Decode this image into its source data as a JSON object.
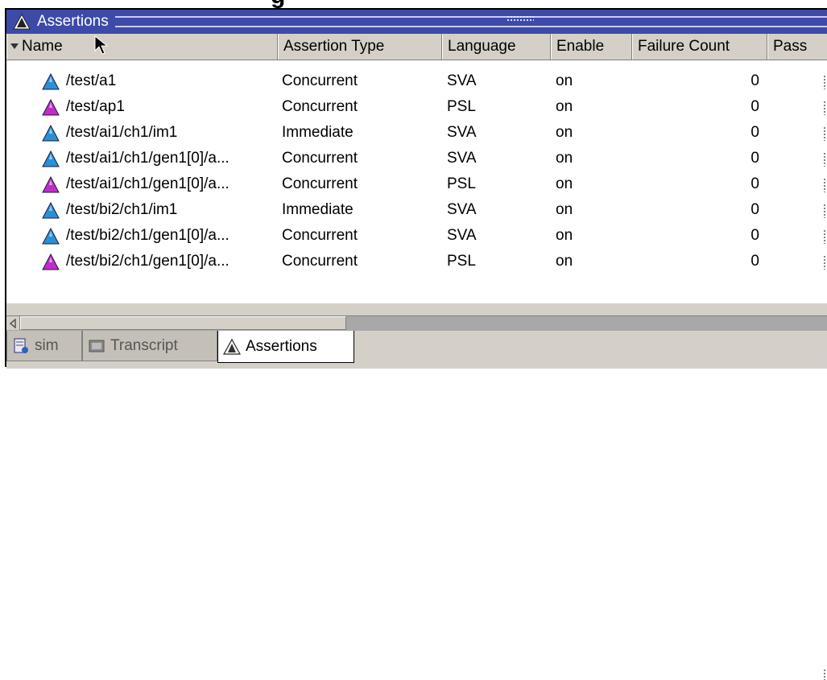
{
  "window": {
    "title": "Assertions",
    "cut_off_heading": "g"
  },
  "columns": [
    {
      "key": "name",
      "label": "Name"
    },
    {
      "key": "type",
      "label": "Assertion Type"
    },
    {
      "key": "language",
      "label": "Language"
    },
    {
      "key": "enable",
      "label": "Enable"
    },
    {
      "key": "failure_count",
      "label": "Failure Count"
    },
    {
      "key": "pass",
      "label": "Pass"
    }
  ],
  "rows": [
    {
      "name": "/test/a1",
      "type": "Concurrent",
      "language": "SVA",
      "enable": "on",
      "failure_count": "0",
      "icon": "sva-assertion-icon",
      "icon_color": "#2b8fd6"
    },
    {
      "name": "/test/ap1",
      "type": "Concurrent",
      "language": "PSL",
      "enable": "on",
      "failure_count": "0",
      "icon": "psl-assertion-icon",
      "icon_color": "#c02cc8"
    },
    {
      "name": "/test/ai1/ch1/im1",
      "type": "Immediate",
      "language": "SVA",
      "enable": "on",
      "failure_count": "0",
      "icon": "sva-assertion-icon",
      "icon_color": "#2b8fd6"
    },
    {
      "name": "/test/ai1/ch1/gen1[0]/a...",
      "type": "Concurrent",
      "language": "SVA",
      "enable": "on",
      "failure_count": "0",
      "icon": "sva-assertion-icon",
      "icon_color": "#2b8fd6"
    },
    {
      "name": "/test/ai1/ch1/gen1[0]/a...",
      "type": "Concurrent",
      "language": "PSL",
      "enable": "on",
      "failure_count": "0",
      "icon": "psl-assertion-icon",
      "icon_color": "#c02cc8"
    },
    {
      "name": "/test/bi2/ch1/im1",
      "type": "Immediate",
      "language": "SVA",
      "enable": "on",
      "failure_count": "0",
      "icon": "sva-assertion-icon",
      "icon_color": "#2b8fd6"
    },
    {
      "name": "/test/bi2/ch1/gen1[0]/a...",
      "type": "Concurrent",
      "language": "SVA",
      "enable": "on",
      "failure_count": "0",
      "icon": "sva-assertion-icon",
      "icon_color": "#2b8fd6"
    },
    {
      "name": "/test/bi2/ch1/gen1[0]/a...",
      "type": "Concurrent",
      "language": "PSL",
      "enable": "on",
      "failure_count": "0",
      "icon": "psl-assertion-icon",
      "icon_color": "#c02cc8"
    }
  ],
  "tabs": [
    {
      "label": "sim",
      "icon": "sim-icon",
      "active": false
    },
    {
      "label": "Transcript",
      "icon": "transcript-icon",
      "active": false
    },
    {
      "label": "Assertions",
      "icon": "assertions-icon",
      "active": true
    }
  ],
  "colors": {
    "titlebar": "#3e4aa8",
    "sva": "#2b8fd6",
    "psl": "#c02cc8"
  }
}
